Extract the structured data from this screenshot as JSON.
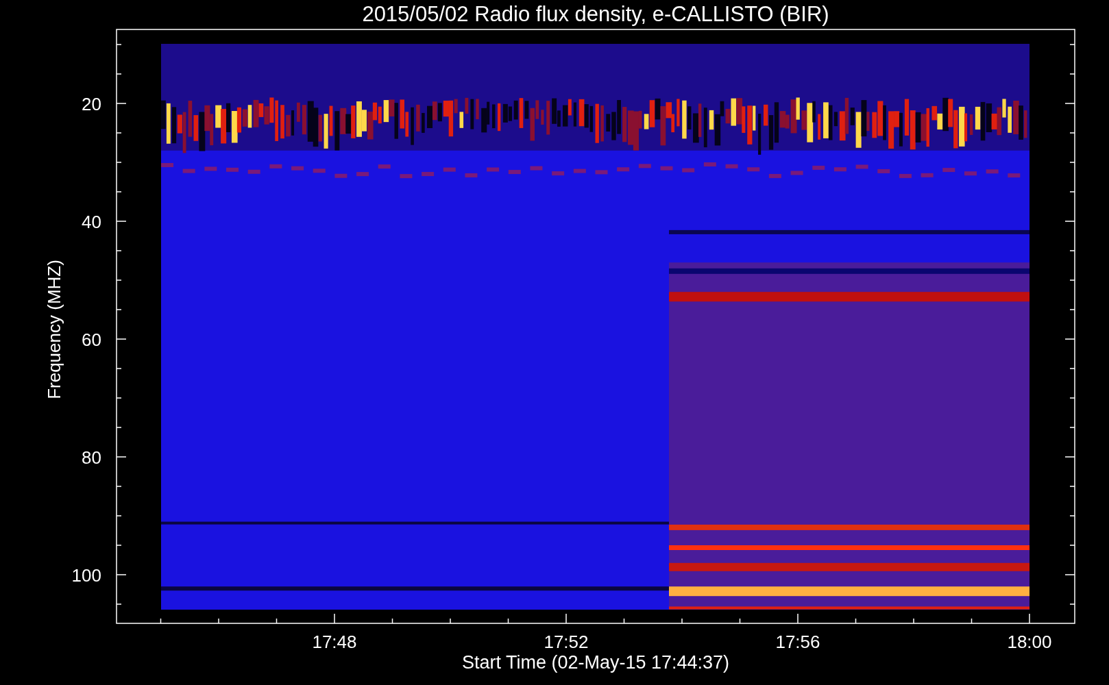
{
  "plot": {
    "title": "2015/05/02  Radio flux density, e-CALLISTO (BIR)",
    "xlabel": "Start Time (02-May-15 17:44:37)",
    "ylabel": "Frequency (MHZ)",
    "xticks": [
      "17:48",
      "17:52",
      "17:56",
      "18:00"
    ],
    "yticks": [
      "20",
      "40",
      "60",
      "80",
      "100"
    ]
  }
}
